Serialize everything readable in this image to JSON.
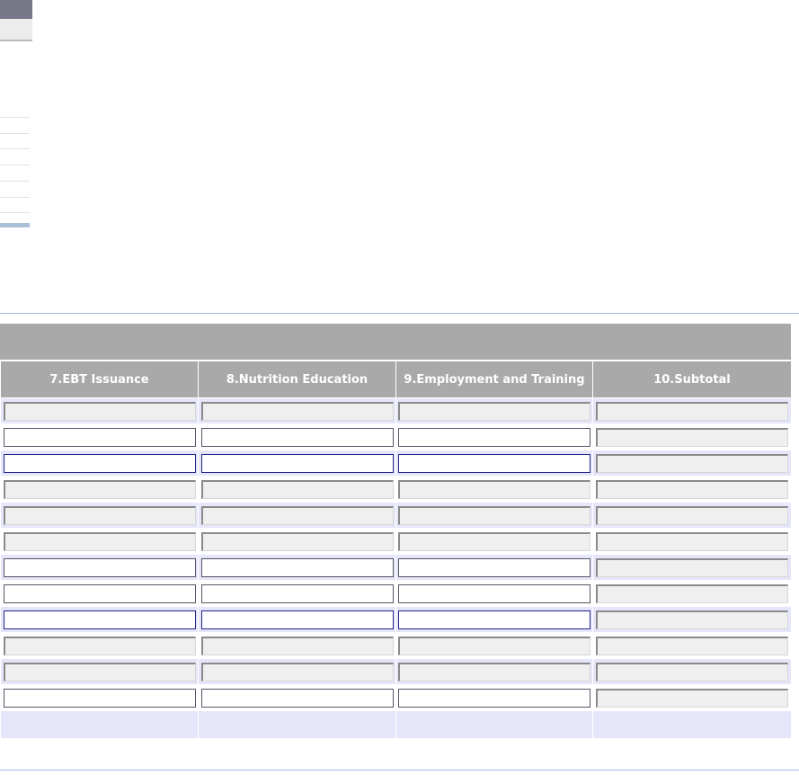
{
  "table": {
    "headers": [
      "7.EBT Issuance",
      "8.Nutrition Education",
      "9.Employment and Training",
      "10.Subtotal"
    ],
    "rows": [
      {
        "cells": [
          "",
          "",
          "",
          ""
        ],
        "editable": [
          false,
          false,
          false,
          false
        ]
      },
      {
        "cells": [
          "",
          "",
          "",
          ""
        ],
        "editable": [
          true,
          true,
          true,
          false
        ]
      },
      {
        "cells": [
          "",
          "",
          "",
          ""
        ],
        "editable": [
          true,
          true,
          true,
          false
        ]
      },
      {
        "cells": [
          "",
          "",
          "",
          ""
        ],
        "editable": [
          false,
          false,
          false,
          false
        ]
      },
      {
        "cells": [
          "",
          "",
          "",
          ""
        ],
        "editable": [
          false,
          false,
          false,
          false
        ]
      },
      {
        "cells": [
          "",
          "",
          "",
          ""
        ],
        "editable": [
          false,
          false,
          false,
          false
        ]
      },
      {
        "cells": [
          "",
          "",
          "",
          ""
        ],
        "editable": [
          true,
          true,
          true,
          false
        ]
      },
      {
        "cells": [
          "",
          "",
          "",
          ""
        ],
        "editable": [
          true,
          true,
          true,
          false
        ]
      },
      {
        "cells": [
          "",
          "",
          "",
          ""
        ],
        "editable": [
          true,
          true,
          true,
          false
        ]
      },
      {
        "cells": [
          "",
          "",
          "",
          ""
        ],
        "editable": [
          false,
          false,
          false,
          false
        ]
      },
      {
        "cells": [
          "",
          "",
          "",
          ""
        ],
        "editable": [
          false,
          false,
          false,
          false
        ]
      },
      {
        "cells": [
          "",
          "",
          "",
          ""
        ],
        "editable": [
          true,
          true,
          true,
          false
        ]
      }
    ]
  },
  "colors": {
    "header_bg": "#a9a9a9",
    "row_band": "#e6e6fa",
    "readonly_field": "#efefef"
  }
}
